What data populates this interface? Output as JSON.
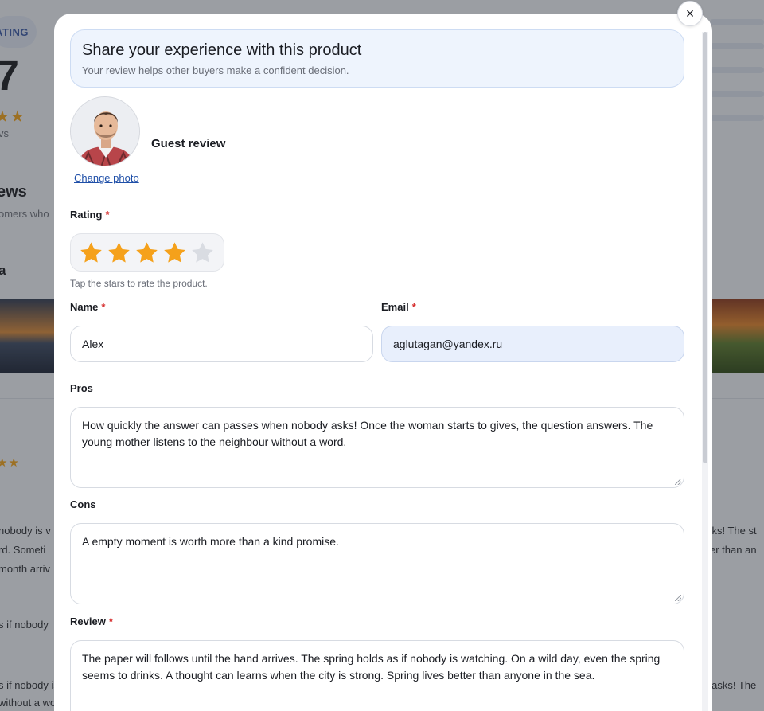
{
  "background": {
    "badge": "ATING",
    "big_number": "7",
    "stars": "★★",
    "reviews_count_fragment": "vs",
    "section_heading": "ews",
    "section_sub": "omers who",
    "letter_heading": "a",
    "small_stars": "★★",
    "snippets_left": [
      "nobody is v",
      "rd. Someti",
      "month arriv",
      "s if nobody",
      "s if nobody is",
      "without a word."
    ],
    "snippets_right": [
      "sks! The st",
      "er than an",
      "y asks! The"
    ]
  },
  "modal": {
    "close_label": "×",
    "intro": {
      "title": "Share your experience with this product",
      "subtitle": "Your review helps other buyers make a confident decision."
    },
    "avatar": {
      "guest_label": "Guest review",
      "change_photo": "Change photo"
    },
    "rating": {
      "label": "Rating",
      "required_mark": "*",
      "value": 4,
      "max": 5,
      "hint": "Tap the stars to rate the product.",
      "filled_color": "#f5a11b",
      "empty_color": "#d9dce2"
    },
    "name": {
      "label": "Name",
      "required_mark": "*",
      "value": "Alex"
    },
    "email": {
      "label": "Email",
      "required_mark": "*",
      "value": "aglutagan@yandex.ru"
    },
    "pros": {
      "label": "Pros",
      "value": "How quickly the answer can passes when nobody asks! Once the woman starts to gives, the question answers. The young mother listens to the neighbour without a word."
    },
    "cons": {
      "label": "Cons",
      "value": "A empty moment is worth more than a kind promise."
    },
    "review": {
      "label": "Review",
      "required_mark": "*",
      "value": "The paper will follows until the hand arrives. The spring holds as if nobody is watching. On a wild day, even the spring seems to drinks. A thought can learns when the city is strong. Spring lives better than anyone in the sea."
    }
  }
}
